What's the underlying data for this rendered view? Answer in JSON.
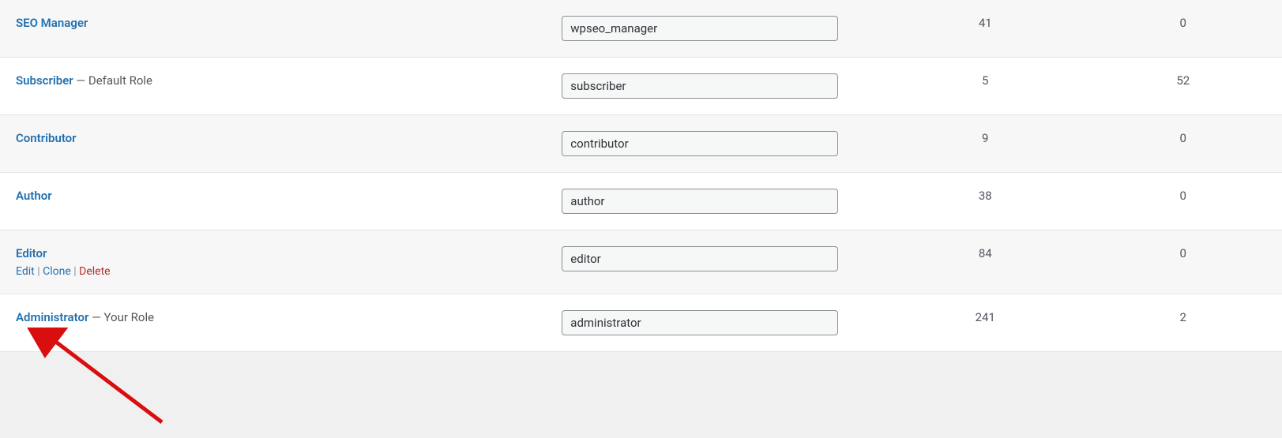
{
  "rows": [
    {
      "name": "SEO Manager",
      "suffix": "",
      "slug": "wpseo_manager",
      "c1": "41",
      "c2": "0",
      "show_actions": false
    },
    {
      "name": "Subscriber",
      "suffix": " — Default Role",
      "slug": "subscriber",
      "c1": "5",
      "c2": "52",
      "show_actions": false
    },
    {
      "name": "Contributor",
      "suffix": "",
      "slug": "contributor",
      "c1": "9",
      "c2": "0",
      "show_actions": false
    },
    {
      "name": "Author",
      "suffix": "",
      "slug": "author",
      "c1": "38",
      "c2": "0",
      "show_actions": false
    },
    {
      "name": "Editor",
      "suffix": "",
      "slug": "editor",
      "c1": "84",
      "c2": "0",
      "show_actions": true
    },
    {
      "name": "Administrator",
      "suffix": " — Your Role",
      "slug": "administrator",
      "c1": "241",
      "c2": "2",
      "show_actions": false
    }
  ],
  "actions": {
    "edit": "Edit",
    "clone": "Clone",
    "delete": "Delete"
  }
}
